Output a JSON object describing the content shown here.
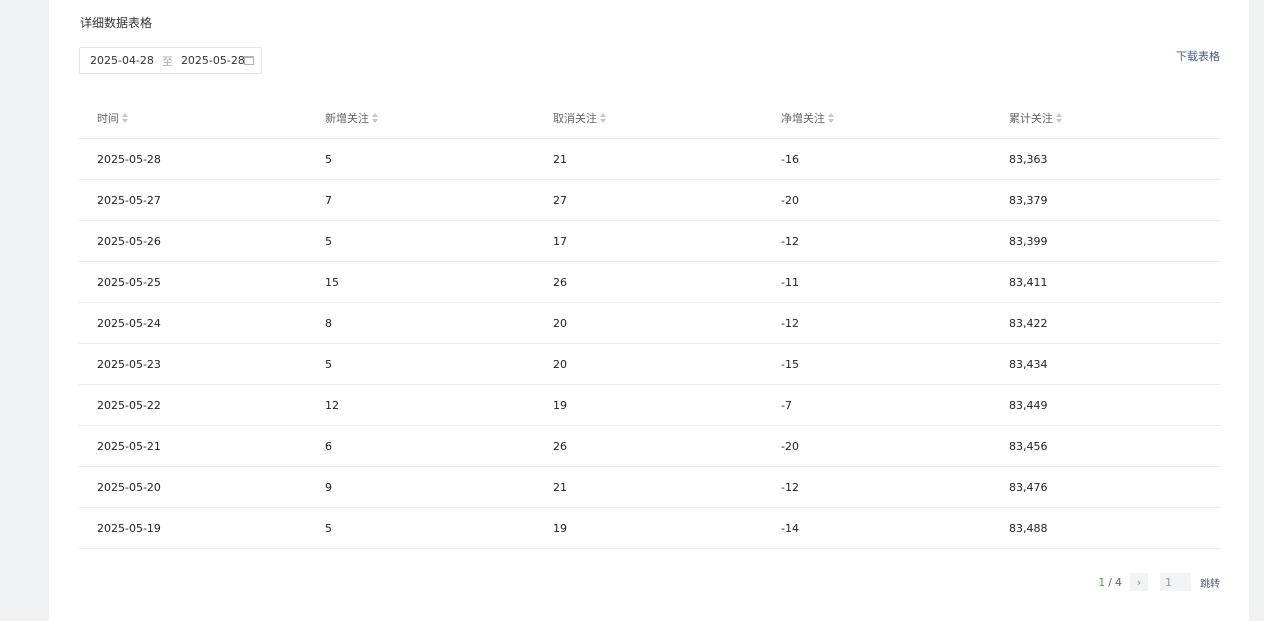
{
  "section": {
    "title": "详细数据表格"
  },
  "date_range": {
    "start": "2025-04-28",
    "separator": "至",
    "end": "2025-05-28"
  },
  "download_label": "下载表格",
  "table": {
    "headers": [
      "时间",
      "新增关注",
      "取消关注",
      "净增关注",
      "累计关注"
    ],
    "rows": [
      [
        "2025-05-28",
        "5",
        "21",
        "-16",
        "83,363"
      ],
      [
        "2025-05-27",
        "7",
        "27",
        "-20",
        "83,379"
      ],
      [
        "2025-05-26",
        "5",
        "17",
        "-12",
        "83,399"
      ],
      [
        "2025-05-25",
        "15",
        "26",
        "-11",
        "83,411"
      ],
      [
        "2025-05-24",
        "8",
        "20",
        "-12",
        "83,422"
      ],
      [
        "2025-05-23",
        "5",
        "20",
        "-15",
        "83,434"
      ],
      [
        "2025-05-22",
        "12",
        "19",
        "-7",
        "83,449"
      ],
      [
        "2025-05-21",
        "6",
        "26",
        "-20",
        "83,456"
      ],
      [
        "2025-05-20",
        "9",
        "21",
        "-12",
        "83,476"
      ],
      [
        "2025-05-19",
        "5",
        "19",
        "-14",
        "83,488"
      ]
    ]
  },
  "pagination": {
    "current": "1",
    "separator": "/",
    "total": "4",
    "next_icon": "›",
    "jump_value": "1",
    "jump_label": "跳转"
  }
}
